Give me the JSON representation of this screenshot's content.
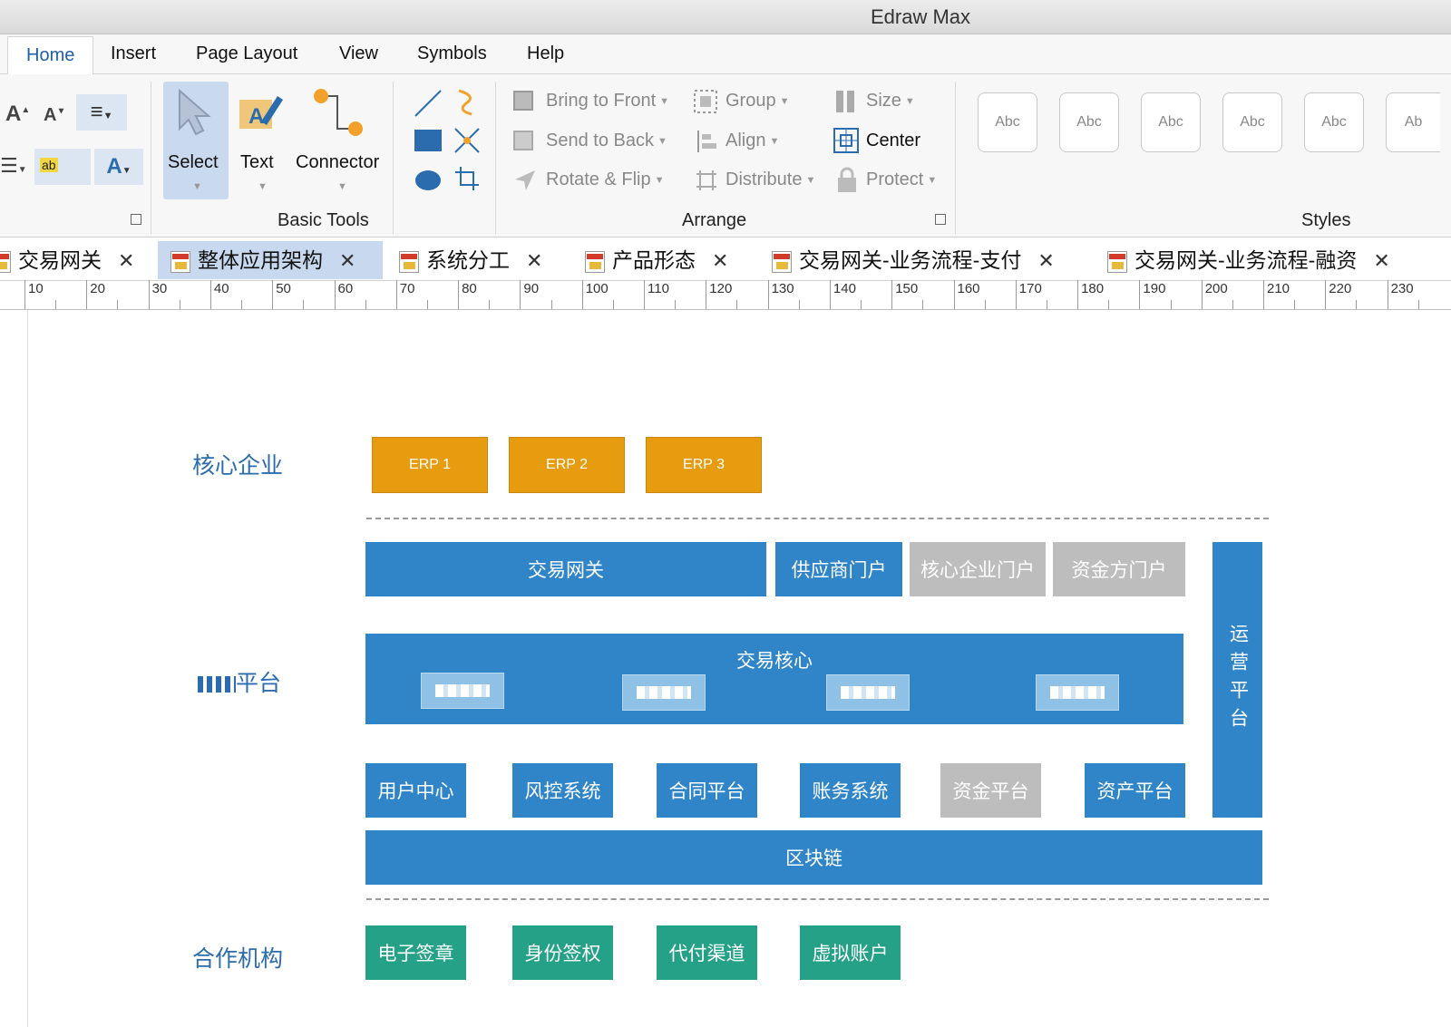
{
  "window": {
    "title": "Edraw Max"
  },
  "menu": {
    "tabs": [
      "Home",
      "Insert",
      "Page Layout",
      "View",
      "Symbols",
      "Help"
    ]
  },
  "ribbon": {
    "basic_tools": {
      "label": "Basic Tools",
      "select": "Select",
      "text": "Text",
      "connector": "Connector"
    },
    "arrange": {
      "label": "Arrange",
      "bring_to_front": "Bring to Front",
      "send_to_back": "Send to Back",
      "rotate_flip": "Rotate & Flip",
      "group": "Group",
      "align": "Align",
      "distribute": "Distribute",
      "size": "Size",
      "center": "Center",
      "protect": "Protect"
    },
    "styles": {
      "label": "Styles",
      "items": [
        "Abc",
        "Abc",
        "Abc",
        "Abc",
        "Abc",
        "Ab"
      ]
    }
  },
  "doc_tabs": [
    "交易网关",
    "整体应用架构",
    "系统分工",
    "产品形态",
    "交易网关-业务流程-支付",
    "交易网关-业务流程-融资"
  ],
  "ruler": {
    "labels": [
      "10",
      "20",
      "30",
      "40",
      "50",
      "60",
      "70",
      "80",
      "90",
      "100",
      "110",
      "120",
      "130",
      "140",
      "150",
      "160",
      "170",
      "180",
      "190",
      "200",
      "210",
      "220",
      "230"
    ]
  },
  "diagram": {
    "rows": {
      "core": "核心企业",
      "platform": "平台",
      "partners": "合作机构"
    },
    "erp": [
      "ERP 1",
      "ERP 2",
      "ERP 3"
    ],
    "gateway": "交易网关",
    "supplier_portal": "供应商门户",
    "core_portal": "核心企业门户",
    "funder_portal": "资金方门户",
    "trade_core": "交易核心",
    "services": [
      "用户中心",
      "风控系统",
      "合同平台",
      "账务系统",
      "资金平台",
      "资产平台"
    ],
    "blockchain": "区块链",
    "ops": "运营平台",
    "partner_items": [
      "电子签章",
      "身份签权",
      "代付渠道",
      "虚拟账户"
    ]
  },
  "colors": {
    "blue": "#2f85c8",
    "gray": "#bdbdbd",
    "orange": "#e69c0e",
    "green": "#24a187",
    "label": "#2b6cae"
  }
}
